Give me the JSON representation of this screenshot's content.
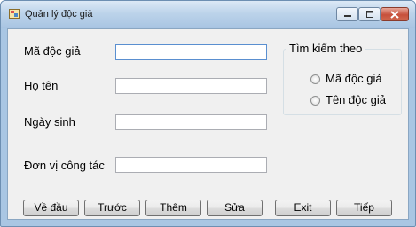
{
  "window": {
    "title": "Quản lý độc giả"
  },
  "form": {
    "ma_doc_gia_label": "Mã độc giả",
    "ma_doc_gia_value": "",
    "ho_ten_label": "Họ tên",
    "ho_ten_value": "",
    "ngay_sinh_label": "Ngày sinh",
    "ngay_sinh_value": "",
    "don_vi_label": "Đơn vị công tác",
    "don_vi_value": ""
  },
  "search": {
    "group_label": "Tìm kiếm theo",
    "option_ma": "Mã độc giả",
    "option_ten": "Tên độc giả"
  },
  "buttons": {
    "first": "Về đầu",
    "prev": "Trước",
    "add": "Thêm",
    "edit": "Sửa",
    "exit": "Exit",
    "next": "Tiếp"
  },
  "colors": {
    "titlebar": "#bcd3ea",
    "close_button": "#c7503b",
    "client_background": "#f0f0f0"
  }
}
